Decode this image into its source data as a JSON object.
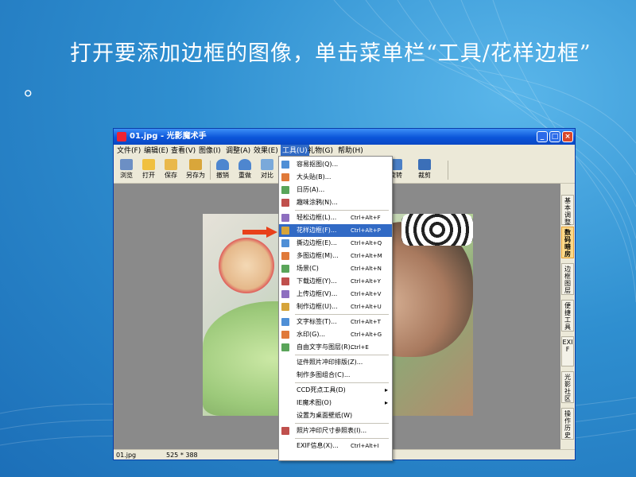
{
  "caption": "打开要添加边框的图像，单击菜单栏“工具/花样边框” 。",
  "window": {
    "title": "01.jpg - 光影魔术手",
    "controls": [
      "_",
      "□",
      "×"
    ]
  },
  "menubar": [
    "文件(F)",
    "编辑(E)",
    "查看(V)",
    "图像(I)",
    "调整(A)",
    "效果(E)",
    "工具(U)",
    "礼物(G)",
    "帮助(H)"
  ],
  "toolbar": [
    {
      "label": "浏览",
      "icon": "browse-icon"
    },
    {
      "label": "打开",
      "icon": "open-folder-icon"
    },
    {
      "label": "保存",
      "icon": "save-icon"
    },
    {
      "label": "另存为",
      "icon": "save-as-icon"
    },
    {
      "label": "撤销",
      "icon": "undo-icon"
    },
    {
      "label": "重做",
      "icon": "redo-icon"
    },
    {
      "label": "对比",
      "icon": "compare-icon"
    },
    {
      "label": "旋转",
      "icon": "rotate-icon"
    },
    {
      "label": "裁剪",
      "icon": "crop-icon"
    }
  ],
  "side_tabs": [
    {
      "label": "基本调整",
      "active": false
    },
    {
      "label": "数码暗房",
      "active": true
    },
    {
      "label": "边框图层",
      "active": false
    },
    {
      "label": "便捷工具",
      "active": false
    },
    {
      "label": "EXIF",
      "active": false
    },
    {
      "label": "光影社区",
      "active": false
    },
    {
      "label": "操作历史",
      "active": false
    }
  ],
  "status": {
    "filename": "01.jpg",
    "dimensions": "525 * 388"
  },
  "tools_menu": [
    {
      "label": "容易抠图(Q)...",
      "shortcut": "",
      "icon": "cutout-icon"
    },
    {
      "label": "大头贴(B)...",
      "shortcut": "",
      "icon": "photo-sticker-icon"
    },
    {
      "label": "日历(A)...",
      "shortcut": "",
      "icon": "calendar-icon"
    },
    {
      "label": "趣味涂鸦(N)...",
      "shortcut": "",
      "icon": "doodle-icon"
    },
    {
      "sep": true
    },
    {
      "label": "轻松边框(L)...",
      "shortcut": "Ctrl+Alt+F",
      "icon": "easy-frame-icon"
    },
    {
      "label": "花样边框(F)...",
      "shortcut": "Ctrl+Alt+P",
      "icon": "fancy-frame-icon",
      "highlighted": true
    },
    {
      "label": "撕边边框(E)...",
      "shortcut": "Ctrl+Alt+Q",
      "icon": "torn-frame-icon"
    },
    {
      "label": "多图边框(M)...",
      "shortcut": "Ctrl+Alt+M",
      "icon": "multi-frame-icon"
    },
    {
      "label": "场景(C)",
      "shortcut": "Ctrl+Alt+N",
      "icon": "scene-icon"
    },
    {
      "label": "下载边框(Y)...",
      "shortcut": "Ctrl+Alt+Y",
      "icon": "download-frame-icon"
    },
    {
      "label": "上传边框(V)...",
      "shortcut": "Ctrl+Alt+V",
      "icon": "upload-frame-icon"
    },
    {
      "label": "制作边框(U)...",
      "shortcut": "Ctrl+Alt+U",
      "icon": "make-frame-icon"
    },
    {
      "sep": true
    },
    {
      "label": "文字标签(T)...",
      "shortcut": "Ctrl+Alt+T",
      "icon": "text-label-icon"
    },
    {
      "label": "水印(G)...",
      "shortcut": "Ctrl+Alt+G",
      "icon": "watermark-icon"
    },
    {
      "label": "自由文字与图层(R)...",
      "shortcut": "Ctrl+E",
      "icon": "free-text-layer-icon"
    },
    {
      "sep": true
    },
    {
      "label": "证件照片冲印排版(Z)...",
      "shortcut": "",
      "icon": ""
    },
    {
      "label": "制作多图组合(C)...",
      "shortcut": "",
      "icon": ""
    },
    {
      "sep": true
    },
    {
      "label": "CCD死点工具(D)",
      "shortcut": "",
      "icon": "",
      "submenu": true
    },
    {
      "label": "IE魔术图(O)",
      "shortcut": "",
      "icon": "",
      "submenu": true
    },
    {
      "label": "设置为桌面壁纸(W)",
      "shortcut": "",
      "icon": ""
    },
    {
      "sep": true
    },
    {
      "label": "照片冲印尺寸参照表(I)...",
      "shortcut": "",
      "icon": "print-size-icon"
    },
    {
      "sep": true
    },
    {
      "label": "EXIF信息(X)...",
      "shortcut": "Ctrl+Alt+I",
      "icon": ""
    }
  ],
  "colors": {
    "accent": "#316ac5",
    "window_frame": "#0b55d9",
    "slide_bg": "#2f8fd0",
    "arrow": "#e8401a"
  }
}
